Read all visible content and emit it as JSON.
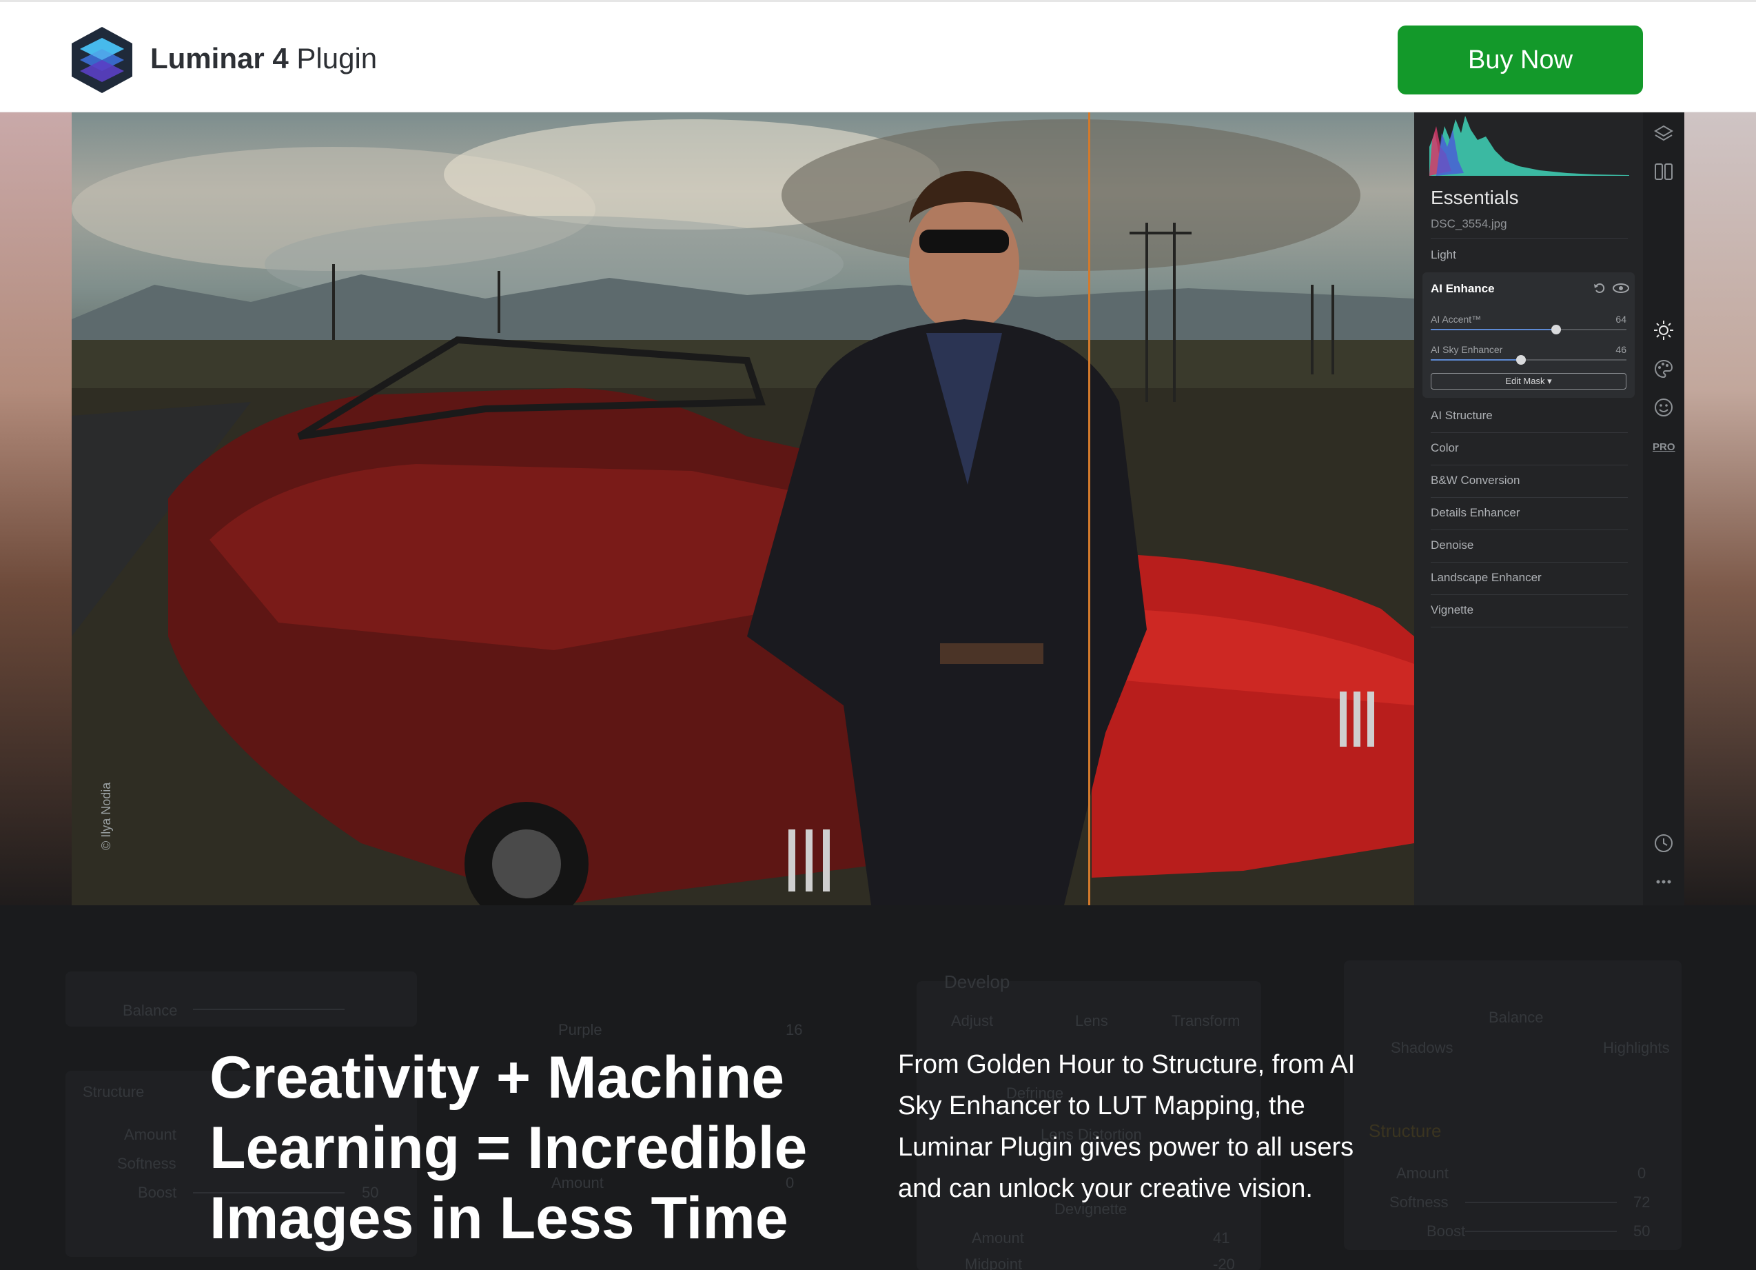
{
  "header": {
    "brand_bold": "Luminar 4",
    "brand_light": " Plugin",
    "buy_label": "Buy Now",
    "buy_color": "#13992a"
  },
  "photo": {
    "credit": "© Ilya Nodia",
    "split_color": "#d37a2c"
  },
  "panel": {
    "title": "Essentials",
    "filename": "DSC_3554.jpg",
    "section_light": "Light",
    "ai_enhance": {
      "title": "AI Enhance",
      "sliders": [
        {
          "label": "AI Accent™",
          "value": "64",
          "level": 0.64
        },
        {
          "label": "AI Sky Enhancer",
          "value": "46",
          "level": 0.46
        }
      ],
      "edit_mask_label": "Edit Mask ▾"
    },
    "tools": [
      "AI Structure",
      "Color",
      "B&W Conversion",
      "Details Enhancer",
      "Denoise",
      "Landscape Enhancer",
      "Vignette"
    ],
    "rail_pro": "PRO"
  },
  "background_ui": {
    "structure": "Structure",
    "amount": "Amount",
    "softness": "Softness",
    "boost": "Boost",
    "balance": "Balance",
    "shadows": "Shadows",
    "highlights": "Highlights",
    "develop": "Develop",
    "adjust": "Adjust",
    "lens": "Lens",
    "transform": "Transform",
    "defringe": "Defringe",
    "lens_distortion": "Lens Distortion",
    "devignette": "Devignette",
    "midpoint": "Midpoint",
    "purple": "Purple",
    "v0": "0",
    "v50": "50",
    "v72": "72",
    "v41": "41",
    "vneg20": "-20",
    "v16": "16"
  },
  "hero": {
    "headline": "Creativity + Machine Learning = Incredible Images in Less Time",
    "subtext": "From Golden Hour to Structure, from AI Sky Enhancer to LUT Mapping, the Luminar Plugin gives power to all users and can unlock your creative vision."
  }
}
